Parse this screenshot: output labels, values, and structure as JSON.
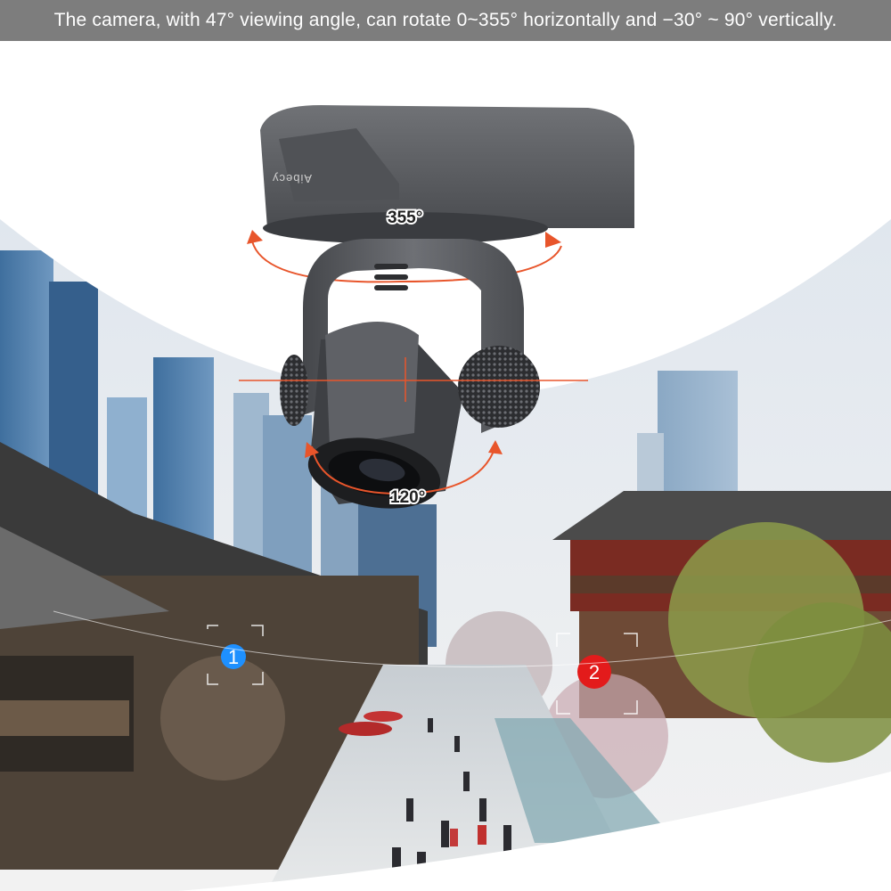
{
  "caption": "The camera, with 47°  viewing angle, can rotate 0~355°  horizontally and −30°  ~ 90°  vertically.",
  "camera": {
    "brand": "Aibecy",
    "pan_label": "355°",
    "tilt_label": "120°"
  },
  "markers": [
    {
      "number": "1",
      "color": "#1e90ff"
    },
    {
      "number": "2",
      "color": "#e31b1b"
    }
  ],
  "colors": {
    "caption_bg": "#7d7d7d",
    "arrow": "#e8552b",
    "camera_body": "#5a5c60"
  }
}
